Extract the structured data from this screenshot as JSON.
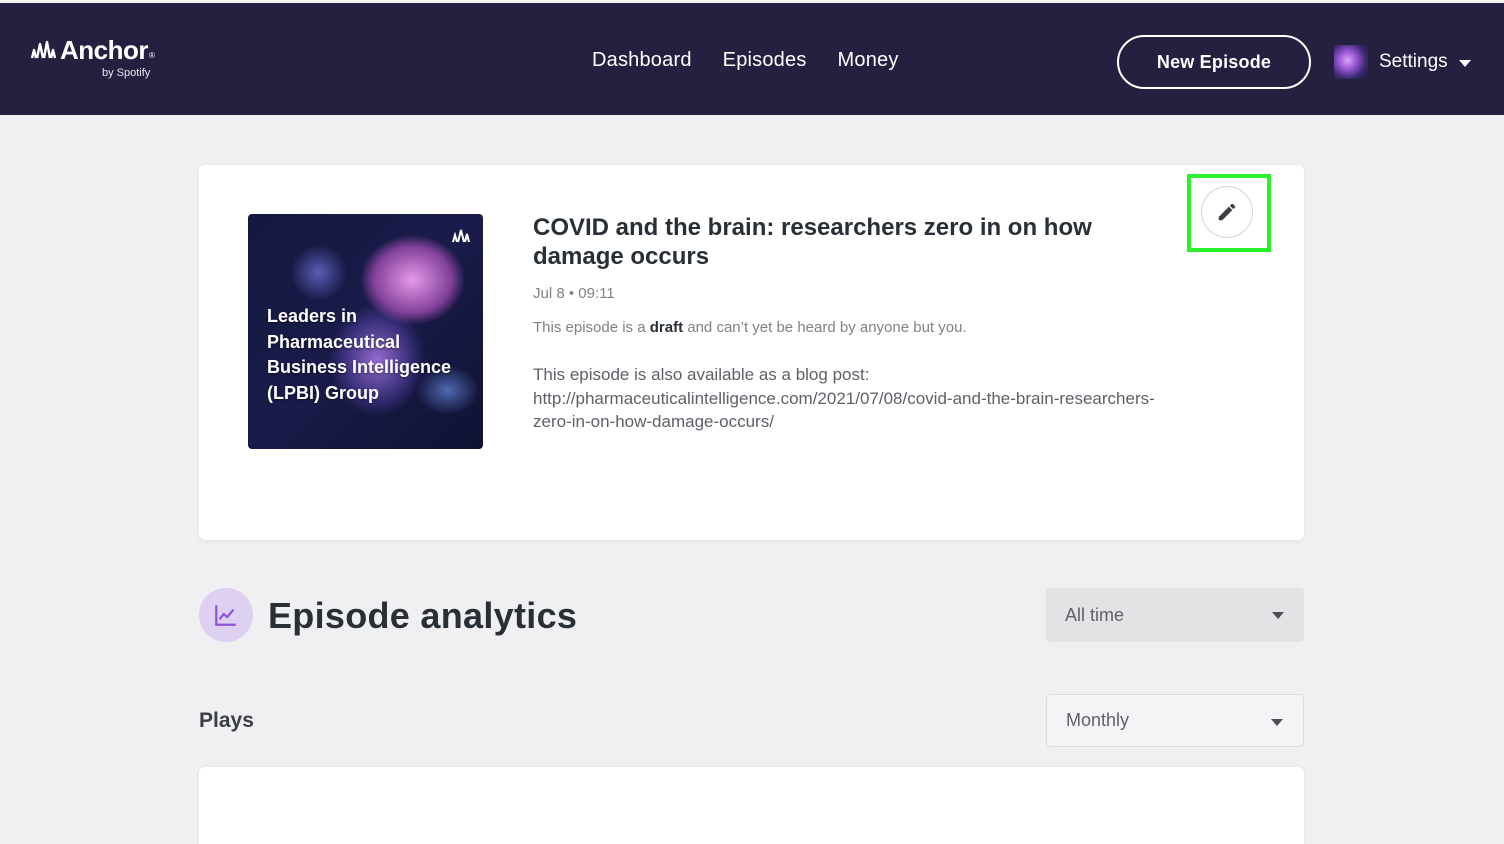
{
  "header": {
    "brand": "Anchor",
    "brand_mark": "®",
    "brand_sub": "by Spotify",
    "nav": [
      {
        "label": "Dashboard"
      },
      {
        "label": "Episodes"
      },
      {
        "label": "Money"
      }
    ],
    "new_episode_label": "New Episode",
    "settings_label": "Settings"
  },
  "episode": {
    "artwork_text": "Leaders in Pharmaceutical Business Intelligence (LPBI) Group",
    "title": "COVID and the brain: researchers zero in on how damage occurs",
    "meta": "Jul 8 • 09:11",
    "draft_prefix": "This episode is a ",
    "draft_word": "draft",
    "draft_suffix": " and can’t yet be heard by anyone but you.",
    "description": "This episode is also available as a blog post: http://pharmaceuticalintelligence.com/2021/07/08/covid-and-the-brain-researchers-zero-in-on-how-damage-occurs/",
    "edit_icon": "pencil-icon"
  },
  "analytics": {
    "title": "Episode analytics",
    "icon": "chart-line-icon",
    "time_range": "All time",
    "plays_label": "Plays",
    "plays_period": "Monthly"
  },
  "colors": {
    "header_bg": "#262040",
    "page_bg": "#f0f0f2",
    "highlight": "#2bf22b",
    "analytics_icon_bg": "#ddd0f3",
    "analytics_icon": "#8c54d8"
  }
}
